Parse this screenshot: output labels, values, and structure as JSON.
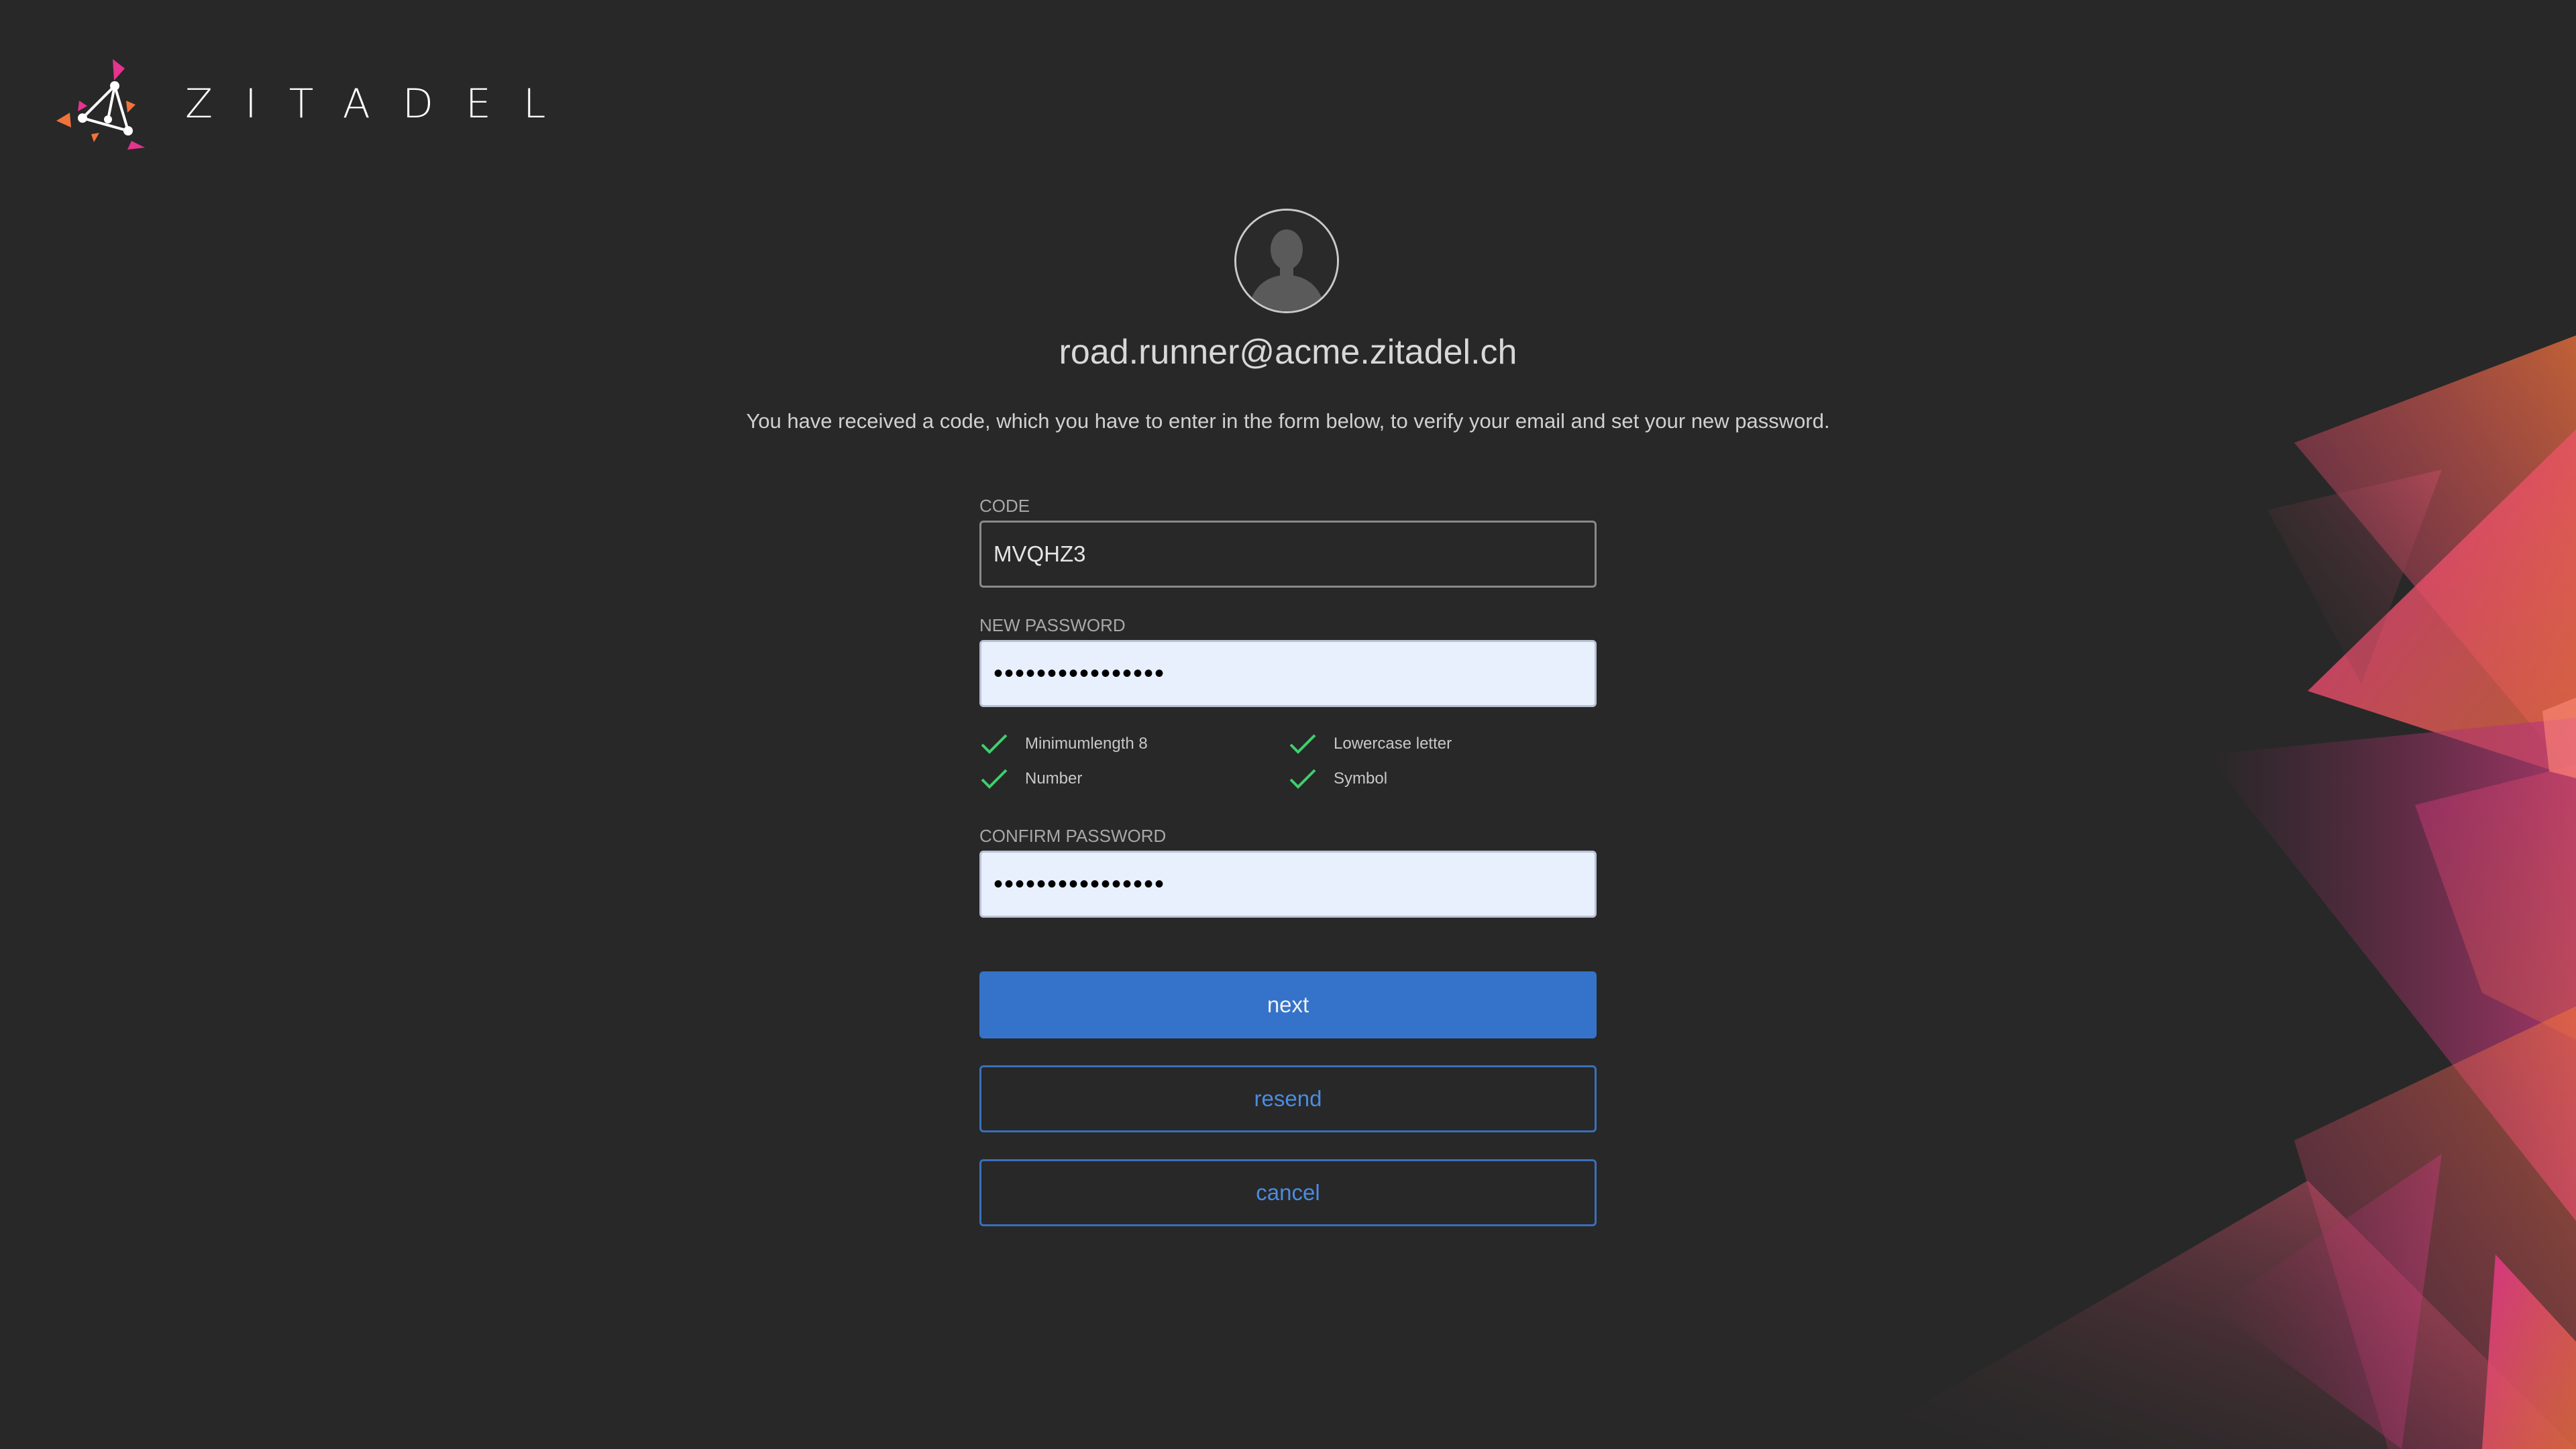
{
  "brand": {
    "name": "ZITADEL",
    "logo_icon": "zitadel-triangle-logo"
  },
  "user": {
    "avatar_icon": "user-avatar-icon",
    "email": "road.runner@acme.zitadel.ch"
  },
  "description": "You have received a code, which you have to enter in the form below, to verify your email and set your new password.",
  "form": {
    "code": {
      "label": "CODE",
      "value": "MVQHZ3"
    },
    "new_password": {
      "label": "NEW PASSWORD",
      "value_masked": "••••••••••••••••"
    },
    "rules": [
      {
        "label": "Minimumlength 8",
        "satisfied": true
      },
      {
        "label": "Lowercase letter",
        "satisfied": true
      },
      {
        "label": "Number",
        "satisfied": true
      },
      {
        "label": "Symbol",
        "satisfied": true
      }
    ],
    "confirm_password": {
      "label": "CONFIRM PASSWORD",
      "value_masked": "••••••••••••••••"
    }
  },
  "buttons": {
    "next": "next",
    "resend": "resend",
    "cancel": "cancel"
  },
  "colors": {
    "background": "#282828",
    "primary": "#3473c9",
    "check": "#3ecf6e",
    "accent_pink": "#e5348f",
    "accent_orange": "#f2733a"
  }
}
